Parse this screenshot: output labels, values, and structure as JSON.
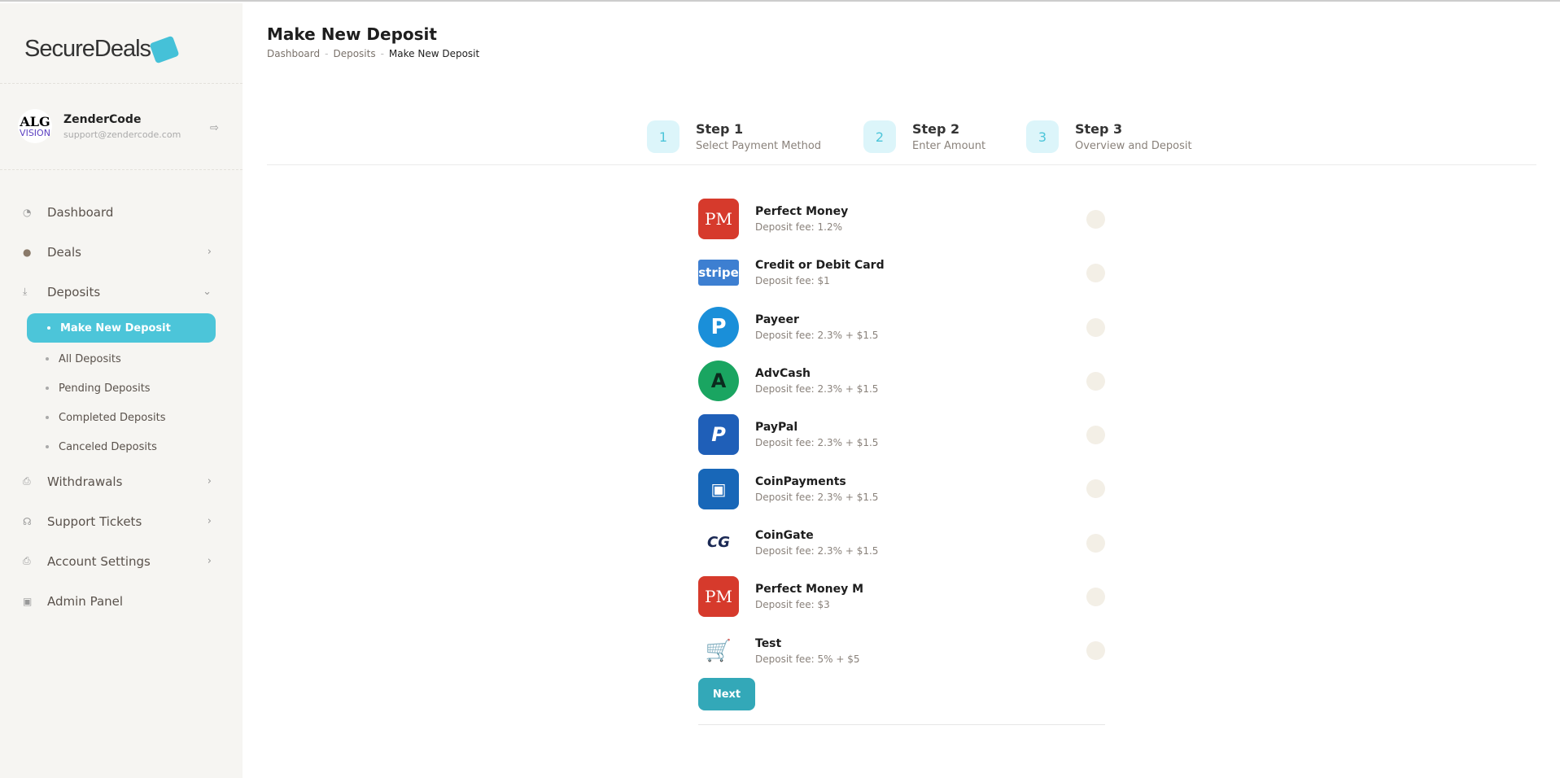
{
  "sidebar": {
    "logo": "SecureDeals",
    "user": {
      "name": "ZenderCode",
      "email": "support@zendercode.com",
      "avatar_text": "ALG",
      "avatar_sub": "VISION"
    },
    "nav": [
      {
        "label": "Dashboard"
      },
      {
        "label": "Deals"
      },
      {
        "label": "Deposits"
      },
      {
        "label": "Withdrawals"
      },
      {
        "label": "Support Tickets"
      },
      {
        "label": "Account Settings"
      },
      {
        "label": "Admin Panel"
      }
    ],
    "deposits_sub": [
      {
        "label": "Make New Deposit"
      },
      {
        "label": "All Deposits"
      },
      {
        "label": "Pending Deposits"
      },
      {
        "label": "Completed Deposits"
      },
      {
        "label": "Canceled Deposits"
      }
    ]
  },
  "header": {
    "title": "Make New Deposit",
    "breadcrumb": [
      "Dashboard",
      "Deposits",
      "Make New Deposit"
    ]
  },
  "steps": [
    {
      "num": "1",
      "title": "Step 1",
      "desc": "Select Payment Method"
    },
    {
      "num": "2",
      "title": "Step 2",
      "desc": "Enter Amount"
    },
    {
      "num": "3",
      "title": "Step 3",
      "desc": "Overview and Deposit"
    }
  ],
  "methods": [
    {
      "name": "Perfect Money",
      "fee": "Deposit fee: 1.2%",
      "icon": "PM"
    },
    {
      "name": "Credit or Debit Card",
      "fee": "Deposit fee: $1",
      "icon": "stripe"
    },
    {
      "name": "Payeer",
      "fee": "Deposit fee: 2.3% + $1.5",
      "icon": "P"
    },
    {
      "name": "AdvCash",
      "fee": "Deposit fee: 2.3% + $1.5",
      "icon": "A"
    },
    {
      "name": "PayPal",
      "fee": "Deposit fee: 2.3% + $1.5",
      "icon": "P"
    },
    {
      "name": "CoinPayments",
      "fee": "Deposit fee: 2.3% + $1.5",
      "icon": "wallet"
    },
    {
      "name": "CoinGate",
      "fee": "Deposit fee: 2.3% + $1.5",
      "icon": "CG"
    },
    {
      "name": "Perfect Money M",
      "fee": "Deposit fee: $3",
      "icon": "PM"
    },
    {
      "name": "Test",
      "fee": "Deposit fee: 5% + $5",
      "icon": "₿"
    }
  ],
  "next_label": "Next"
}
